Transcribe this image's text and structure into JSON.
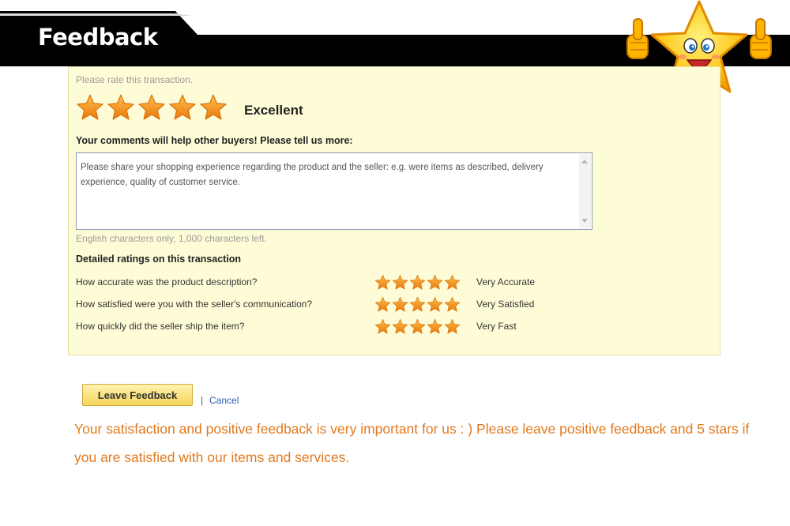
{
  "header": {
    "title": "Feedback"
  },
  "mascot": {
    "icon": "star-mascot-thumbs-up-icon"
  },
  "rating": {
    "prompt": "Please rate this transaction.",
    "stars": 5,
    "max_stars": 5,
    "label": "Excellent"
  },
  "comments": {
    "heading": "Your comments will help other buyers! Please tell us more:",
    "placeholder": "Please share your shopping experience regarding the product and the seller: e.g. were items as described, delivery experience, quality of customer service.",
    "char_hint": "English characters only, 1,000 characters left."
  },
  "detailed": {
    "heading": "Detailed ratings on this transaction",
    "items": [
      {
        "question": "How accurate was the product description?",
        "stars": 5,
        "value": "Very Accurate"
      },
      {
        "question": "How satisfied were you with the seller's communication?",
        "stars": 5,
        "value": "Very Satisfied"
      },
      {
        "question": "How quickly did the seller ship the item?",
        "stars": 5,
        "value": "Very Fast"
      }
    ]
  },
  "actions": {
    "leave_label": "Leave Feedback",
    "separator": "|",
    "cancel_label": "Cancel"
  },
  "promo": {
    "text": "Your satisfaction and positive feedback is very important for us : ) Please leave positive feedback and 5 stars if you are satisfied with our items and services."
  },
  "colors": {
    "panel_bg": "#fefcd7",
    "star": "#f39c12",
    "promo_text": "#e07a1f",
    "link": "#2a5db0"
  }
}
